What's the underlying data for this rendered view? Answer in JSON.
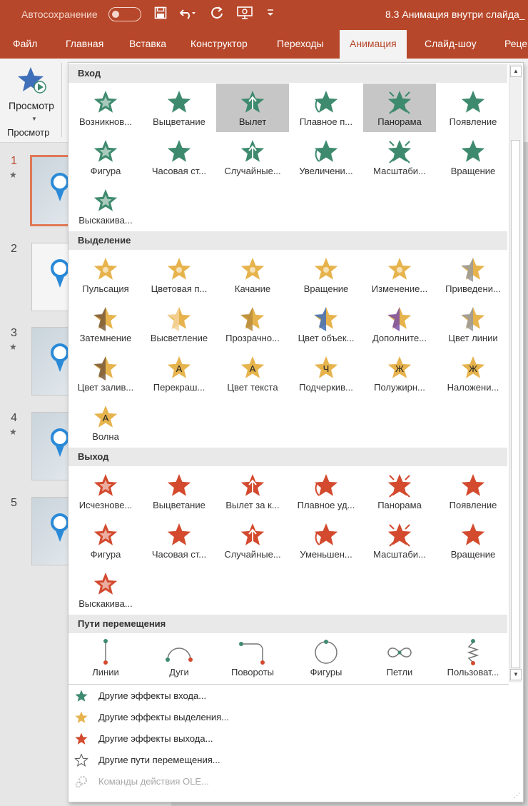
{
  "colors": {
    "accent": "#b7472a",
    "entrance": "#3e8a6e",
    "emphasis": "#e6b34d",
    "exit": "#d34a2e",
    "selected_bg": "#c6c6c6"
  },
  "titlebar": {
    "autosave_label": "Автосохранение",
    "document_title": "8.3 Анимация внутри слайда_",
    "save_icon": "save-icon",
    "undo_icon": "undo-icon",
    "redo_icon": "redo-icon",
    "present_icon": "present-icon",
    "customize_icon": "customize-qat-icon"
  },
  "tabs": [
    {
      "label": "Файл"
    },
    {
      "label": "Главная"
    },
    {
      "label": "Вставка"
    },
    {
      "label": "Конструктор"
    },
    {
      "label": "Переходы"
    },
    {
      "label": "Анимация",
      "active": true
    },
    {
      "label": "Слайд-шоу"
    },
    {
      "label": "Реце"
    }
  ],
  "ribbon": {
    "preview_label": "Просмотр",
    "preview_group": "Просмотр"
  },
  "slides": [
    {
      "number": "1",
      "active": true,
      "animated": true
    },
    {
      "number": "2",
      "active": false,
      "animated": false
    },
    {
      "number": "3",
      "active": false,
      "animated": true
    },
    {
      "number": "4",
      "active": false,
      "animated": true
    },
    {
      "number": "5",
      "active": false,
      "animated": false
    }
  ],
  "gallery": {
    "sections": [
      {
        "title": "Вход",
        "kind": "entrance",
        "items": [
          {
            "label": "Возникнов...",
            "icon": "appear-star-icon"
          },
          {
            "label": "Выцветание",
            "icon": "fade-star-icon"
          },
          {
            "label": "Вылет",
            "icon": "fly-in-star-icon",
            "selected": true
          },
          {
            "label": "Плавное п...",
            "icon": "float-in-star-icon"
          },
          {
            "label": "Панорама",
            "icon": "split-star-icon",
            "selected": true
          },
          {
            "label": "Появление",
            "icon": "wipe-star-icon"
          },
          {
            "label": "Фигура",
            "icon": "shape-star-icon"
          },
          {
            "label": "Часовая ст...",
            "icon": "wheel-star-icon"
          },
          {
            "label": "Случайные...",
            "icon": "random-bars-star-icon"
          },
          {
            "label": "Увеличени...",
            "icon": "grow-turn-star-icon"
          },
          {
            "label": "Масштаби...",
            "icon": "zoom-star-icon"
          },
          {
            "label": "Вращение",
            "icon": "swivel-star-icon"
          },
          {
            "label": "Выскакива...",
            "icon": "bounce-star-icon"
          }
        ]
      },
      {
        "title": "Выделение",
        "kind": "emphasis",
        "items": [
          {
            "label": "Пульсация",
            "icon": "pulse-star-icon"
          },
          {
            "label": "Цветовая п...",
            "icon": "color-pulse-star-icon"
          },
          {
            "label": "Качание",
            "icon": "teeter-star-icon"
          },
          {
            "label": "Вращение",
            "icon": "spin-star-icon"
          },
          {
            "label": "Изменение...",
            "icon": "grow-shrink-star-icon"
          },
          {
            "label": "Приведени...",
            "icon": "desaturate-star-icon"
          },
          {
            "label": "Затемнение",
            "icon": "darken-star-icon"
          },
          {
            "label": "Высветление",
            "icon": "lighten-star-icon"
          },
          {
            "label": "Прозрачно...",
            "icon": "transparency-star-icon"
          },
          {
            "label": "Цвет объек...",
            "icon": "object-color-star-icon"
          },
          {
            "label": "Дополните...",
            "icon": "complementary-color-star-icon"
          },
          {
            "label": "Цвет линии",
            "icon": "line-color-star-icon"
          },
          {
            "label": "Цвет залив...",
            "icon": "fill-color-star-icon"
          },
          {
            "label": "Перекраш...",
            "icon": "brush-color-star-icon",
            "glyph": "А"
          },
          {
            "label": "Цвет текста",
            "icon": "font-color-star-icon",
            "glyph": "А"
          },
          {
            "label": "Подчеркив...",
            "icon": "underline-star-icon",
            "glyph": "Ч"
          },
          {
            "label": "Полужирн...",
            "icon": "bold-flash-star-icon",
            "glyph": "Ж"
          },
          {
            "label": "Наложени...",
            "icon": "bold-reveal-star-icon",
            "glyph": "Ж"
          },
          {
            "label": "Волна",
            "icon": "wave-star-icon",
            "glyph": "А"
          }
        ]
      },
      {
        "title": "Выход",
        "kind": "exit",
        "items": [
          {
            "label": "Исчезнове...",
            "icon": "disappear-star-icon"
          },
          {
            "label": "Выцветание",
            "icon": "fade-out-star-icon"
          },
          {
            "label": "Вылет за к...",
            "icon": "fly-out-star-icon"
          },
          {
            "label": "Плавное уд...",
            "icon": "float-out-star-icon"
          },
          {
            "label": "Панорама",
            "icon": "split-out-star-icon"
          },
          {
            "label": "Появление",
            "icon": "wipe-out-star-icon"
          },
          {
            "label": "Фигура",
            "icon": "shape-out-star-icon"
          },
          {
            "label": "Часовая ст...",
            "icon": "wheel-out-star-icon"
          },
          {
            "label": "Случайные...",
            "icon": "random-bars-out-star-icon"
          },
          {
            "label": "Уменьшен...",
            "icon": "shrink-turn-star-icon"
          },
          {
            "label": "Масштаби...",
            "icon": "zoom-out-star-icon"
          },
          {
            "label": "Вращение",
            "icon": "swivel-out-star-icon"
          },
          {
            "label": "Выскакива...",
            "icon": "bounce-out-star-icon"
          }
        ]
      },
      {
        "title": "Пути перемещения",
        "kind": "path",
        "items": [
          {
            "label": "Линии",
            "icon": "line-path-icon"
          },
          {
            "label": "Дуги",
            "icon": "arc-path-icon"
          },
          {
            "label": "Повороты",
            "icon": "turn-path-icon"
          },
          {
            "label": "Фигуры",
            "icon": "shape-path-icon"
          },
          {
            "label": "Петли",
            "icon": "loop-path-icon"
          },
          {
            "label": "Пользоват...",
            "icon": "custom-path-icon"
          }
        ]
      }
    ],
    "more": [
      {
        "label": "Другие эффекты входа...",
        "icon": "entrance-star-icon",
        "kind": "entrance",
        "disabled": false
      },
      {
        "label": "Другие эффекты выделения...",
        "icon": "emphasis-star-icon",
        "kind": "emphasis",
        "disabled": false
      },
      {
        "label": "Другие эффекты выхода...",
        "icon": "exit-star-icon",
        "kind": "exit",
        "disabled": false
      },
      {
        "label": "Другие пути перемещения...",
        "icon": "outline-star-icon",
        "kind": "outline",
        "disabled": false
      },
      {
        "label": "Команды действия OLE...",
        "icon": "ole-gear-icon",
        "kind": "ole",
        "disabled": true
      }
    ]
  }
}
